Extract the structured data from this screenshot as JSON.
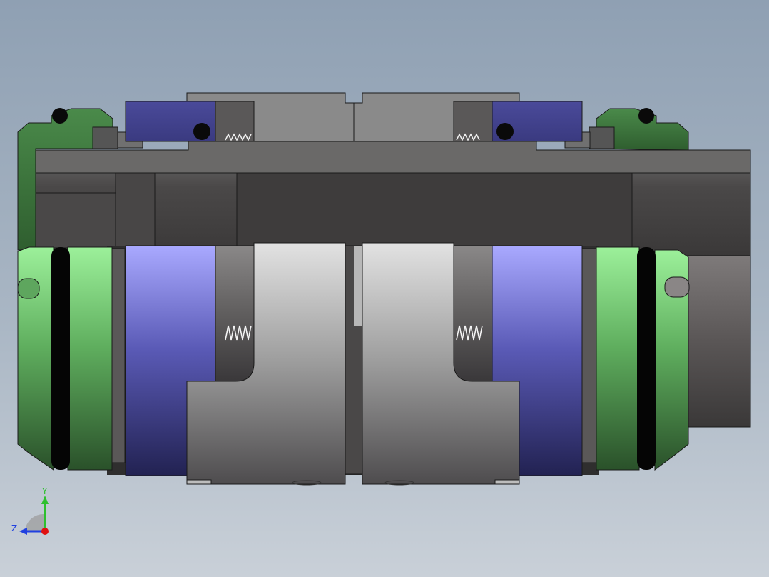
{
  "viewport": {
    "background_top": "#8fa0b3",
    "background_bottom": "#c9d0d8"
  },
  "model": {
    "parts": [
      "shaft-sleeve",
      "gland-plate",
      "rotating-seal-ring",
      "stationary-seal-ring",
      "drive-collar",
      "o-ring",
      "spring"
    ],
    "colors": {
      "green_light": "#8fe08c",
      "green_dark": "#2f5a2f",
      "blue_light": "#a6a6ff",
      "blue_dark": "#242456",
      "gray_light": "#dcdcdc",
      "gray_dark": "#3c3a3c",
      "black": "#0a0a0a"
    }
  },
  "triad": {
    "y_label": "Y",
    "z_label": "Z",
    "y_color": "#2ec02e",
    "z_color": "#2040e0",
    "x_color": "#e01010"
  }
}
